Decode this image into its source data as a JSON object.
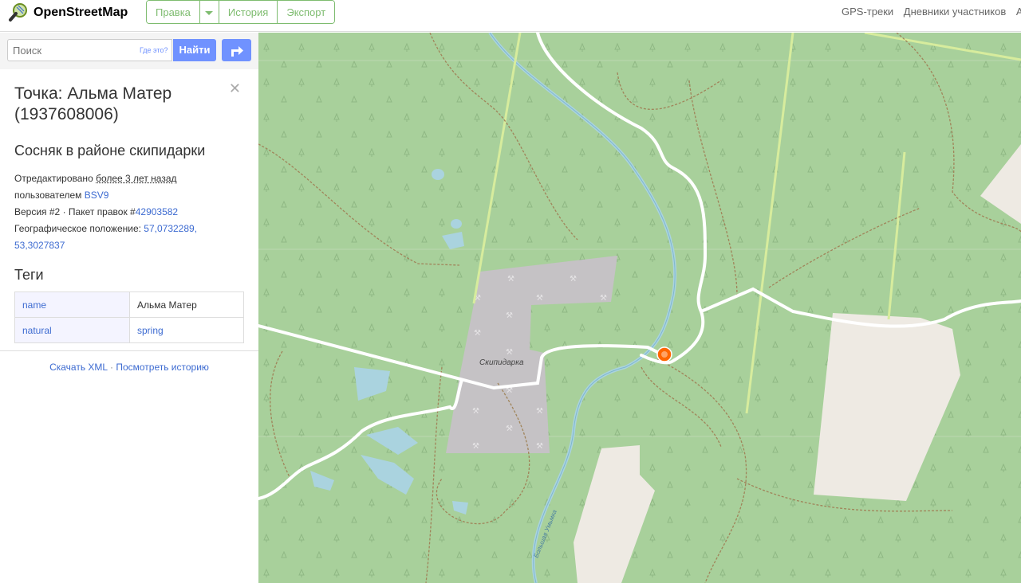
{
  "header": {
    "logo_text": "OpenStreetMap",
    "edit_label": "Правка",
    "history_label": "История",
    "export_label": "Экспорт",
    "right_links": [
      "GPS-треки",
      "Дневники участников",
      "Ав"
    ]
  },
  "search": {
    "placeholder": "Поиск",
    "where_label": "Где это?",
    "find_label": "Найти"
  },
  "feature": {
    "title": "Точка: Альма Матер (1937608006)",
    "subtitle": "Сосняк в районе скипидарки",
    "edited_prefix": "Отредактировано ",
    "edited_when": "более 3 лет назад",
    "user_prefix": "пользователем ",
    "user": "BSV9",
    "version_text": "Версия #2 · Пакет правок #",
    "changeset": "42903582",
    "location_prefix": "Географическое положение: ",
    "location": "57,0732289, 53,3027837",
    "tags_heading": "Теги",
    "tags": [
      {
        "key": "name",
        "value": "Альма Матер"
      },
      {
        "key": "natural",
        "value": "spring"
      }
    ],
    "download_xml": "Скачать XML",
    "separator": " · ",
    "view_history": "Посмотреть историю"
  },
  "map": {
    "place_label": "Скипидарка",
    "river_label": "Большая Умьмка",
    "forest_color": "#a8d09b",
    "quarry_color": "#c5c2c5",
    "clearing_color": "#eeeae3",
    "water_color": "#aad3df",
    "road_color": "#ffffff",
    "track_color": "#a0845a",
    "marker_color": "#ff6600"
  }
}
